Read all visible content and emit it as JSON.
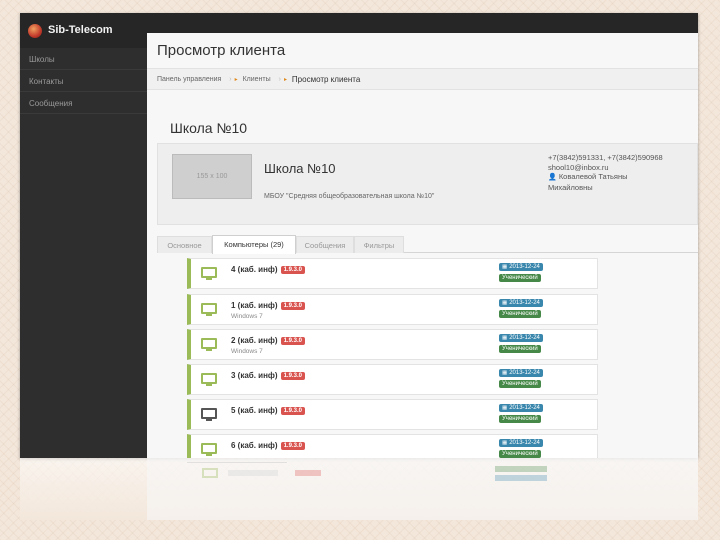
{
  "app": {
    "brand": "Sib-Telecom"
  },
  "sidebar": {
    "items": [
      {
        "label": "Школы"
      },
      {
        "label": "Контакты"
      },
      {
        "label": "Сообщения"
      }
    ]
  },
  "page": {
    "title": "Просмотр клиента"
  },
  "breadcrumb": {
    "items": [
      "Панель управления",
      "Клиенты",
      "Просмотр клиента"
    ]
  },
  "client": {
    "heading": "Школа №10",
    "logo_placeholder": "155 x 100",
    "name": "Школа №10",
    "full_name": "МБОУ \"Средняя общеобразовательная школа №10\"",
    "phones": "+7(3842)591331, +7(3842)590968",
    "email": "shool10@inbox.ru",
    "contact_person_line1": "Ковалевой Татьяны",
    "contact_person_line2": "Михайловны"
  },
  "tabs": [
    {
      "label": "Основное",
      "active": false
    },
    {
      "label": "Компьютеры (29)",
      "active": true
    },
    {
      "label": "Сообщения",
      "active": false
    },
    {
      "label": "Фильтры",
      "active": false
    }
  ],
  "computers": [
    {
      "name": "4 (каб. инф)",
      "version": "1.9.3.0",
      "os": "",
      "date": "2013-12-24",
      "type": "Ученический",
      "icon": "monitor-icon-green"
    },
    {
      "name": "1 (каб. инф)",
      "version": "1.9.3.0",
      "os": "Windows 7",
      "date": "2013-12-24",
      "type": "Ученический",
      "icon": "monitor-icon-green"
    },
    {
      "name": "2 (каб. инф)",
      "version": "1.9.3.0",
      "os": "Windows 7",
      "date": "2013-12-24",
      "type": "Ученический",
      "icon": "monitor-icon-green"
    },
    {
      "name": "3 (каб. инф)",
      "version": "1.9.3.0",
      "os": "",
      "date": "2013-12-24",
      "type": "Ученический",
      "icon": "monitor-icon-green"
    },
    {
      "name": "5 (каб. инф)",
      "version": "1.9.3.0",
      "os": "",
      "date": "2013-12-24",
      "type": "Ученический",
      "icon": "monitor-icon-dark"
    },
    {
      "name": "6 (каб. инф)",
      "version": "1.9.3.0",
      "os": "",
      "date": "2013-12-24",
      "type": "Ученический",
      "icon": "monitor-icon-green"
    }
  ],
  "colors": {
    "sidebar_bg": "#2e2e2e",
    "accent_green": "#9bbb59",
    "version_red": "#d9534f",
    "date_blue": "#3a87ad",
    "type_green": "#468847",
    "crumb_orange": "#e08a1e"
  }
}
